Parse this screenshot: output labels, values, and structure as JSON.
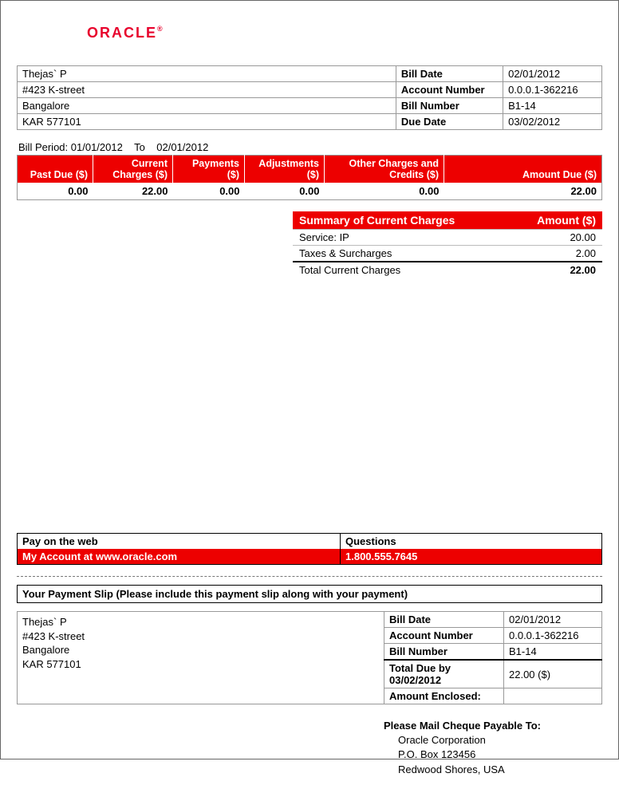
{
  "logo": {
    "text": "ORACLE",
    "reg": "®"
  },
  "customer": {
    "name": "Thejas` P",
    "street": "#423 K-street",
    "city": "Bangalore",
    "region": "KAR 577101"
  },
  "bill_meta": {
    "labels": {
      "bill_date": "Bill Date",
      "account_number": "Account Number",
      "bill_number": "Bill Number",
      "due_date": "Due Date"
    },
    "bill_date": "02/01/2012",
    "account_number": "0.0.0.1-362216",
    "bill_number": "B1-14",
    "due_date": "03/02/2012"
  },
  "bill_period": {
    "prefix": "Bill Period:",
    "from": "01/01/2012",
    "sep": "To",
    "to": "02/01/2012"
  },
  "charges": {
    "headers": {
      "past_due": "Past Due ($)",
      "current": "Current Charges ($)",
      "payments": "Payments ($)",
      "adjustments": "Adjustments ($)",
      "other": "Other Charges and Credits ($)",
      "amount_due": "Amount Due ($)"
    },
    "values": {
      "past_due": "0.00",
      "current": "22.00",
      "payments": "0.00",
      "adjustments": "0.00",
      "other": "0.00",
      "amount_due": "22.00"
    }
  },
  "summary": {
    "header_left": "Summary of Current Charges",
    "header_right": "Amount ($)",
    "rows": [
      {
        "label": "Service: IP",
        "amount": "20.00"
      },
      {
        "label": "Taxes & Surcharges",
        "amount": "2.00"
      }
    ],
    "total": {
      "label": "Total Current Charges",
      "amount": "22.00"
    }
  },
  "payq": {
    "pay_label": "Pay on the web",
    "pay_value": "My Account at www.oracle.com",
    "q_label": "Questions",
    "q_value": "1.800.555.7645"
  },
  "slip": {
    "title": "Your Payment Slip (Please include this payment slip along with your payment)",
    "info": {
      "labels": {
        "bill_date": "Bill Date",
        "account_number": "Account Number",
        "bill_number": "Bill Number",
        "total_due": "Total Due by 03/02/2012",
        "amount_enclosed": "Amount Enclosed:"
      },
      "bill_date": "02/01/2012",
      "account_number": "0.0.0.1-362216",
      "bill_number": "B1-14",
      "total_due": "22.00 ($)",
      "amount_enclosed": ""
    },
    "mail": {
      "header": "Please Mail Cheque Payable To:",
      "line1": "Oracle Corporation",
      "line2": "P.O. Box 123456",
      "line3": "Redwood Shores, USA"
    }
  }
}
